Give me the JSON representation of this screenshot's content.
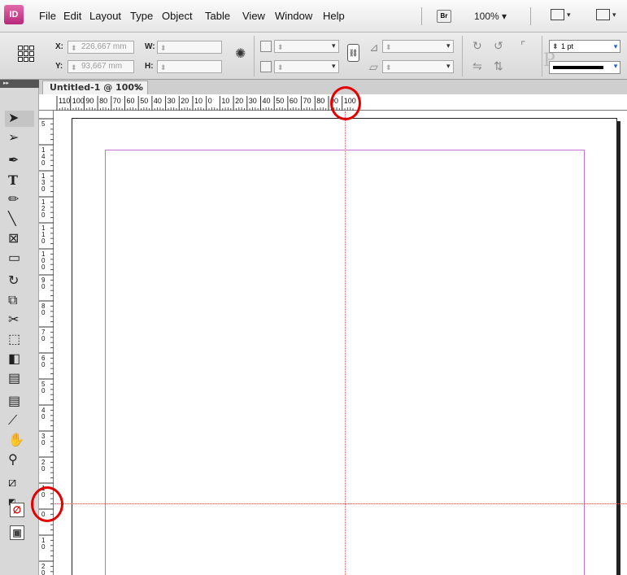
{
  "app": {
    "logo": "ID"
  },
  "menubar": {
    "items": [
      "File",
      "Edit",
      "Layout",
      "Type",
      "Object",
      "Table",
      "View",
      "Window",
      "Help"
    ],
    "bridge_button": "Br",
    "zoom": "100% ▾"
  },
  "control_panel": {
    "x_label": "X:",
    "x_value": "226,667 mm",
    "y_label": "Y:",
    "y_value": "93,667 mm",
    "w_label": "W:",
    "h_label": "H:",
    "stroke_weight": "1 pt",
    "accent_color": "#1d5fd4"
  },
  "tools_panel": {
    "collapse_label": "▸▸"
  },
  "document": {
    "tab_title": "Untitled-1 @ 100%",
    "close_glyph": "×"
  },
  "hruler": {
    "labels": [
      "110",
      "100",
      "90",
      "80",
      "70",
      "60",
      "50",
      "40",
      "30",
      "20",
      "10",
      "0",
      "10",
      "20",
      "30",
      "40",
      "50",
      "60",
      "70",
      "80",
      "90",
      "100"
    ]
  },
  "vruler": {
    "labels": [
      "5",
      "140",
      "130",
      "120",
      "110",
      "100",
      "90",
      "80",
      "70",
      "60",
      "50",
      "40",
      "30",
      "20",
      "10",
      "0",
      "10",
      "20"
    ]
  },
  "colors": {
    "margin_guide": "#c070d0",
    "ruler_guide": "#e06060",
    "highlight_ring": "#e30000"
  }
}
